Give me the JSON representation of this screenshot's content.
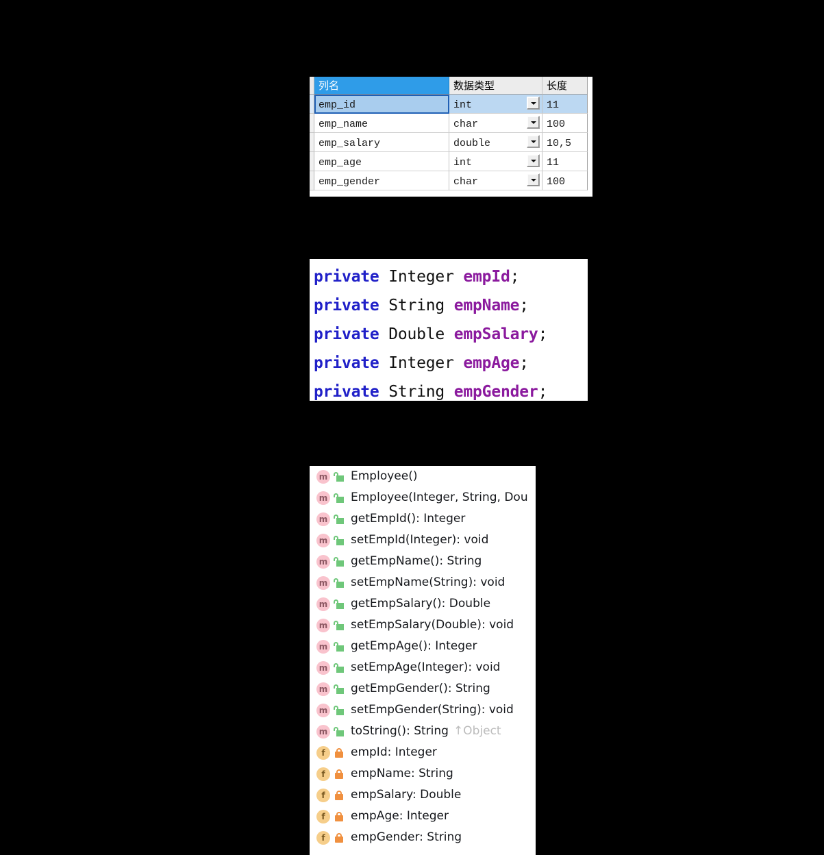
{
  "db_table": {
    "headers": [
      "列名",
      "数据类型",
      "长度"
    ],
    "rows": [
      {
        "column_name": "emp_id",
        "data_type": "int",
        "length": "11",
        "selected": true
      },
      {
        "column_name": "emp_name",
        "data_type": "char",
        "length": "100",
        "selected": false
      },
      {
        "column_name": "emp_salary",
        "data_type": "double",
        "length": "10,5",
        "selected": false
      },
      {
        "column_name": "emp_age",
        "data_type": "int",
        "length": "11",
        "selected": false
      },
      {
        "column_name": "emp_gender",
        "data_type": "char",
        "length": "100",
        "selected": false
      }
    ],
    "dropdown_icon": "chevron-down-icon",
    "header_accent_color": "#2f9ce8",
    "selection_color": "#bcd8f2"
  },
  "code_block": {
    "language": "java",
    "keyword_color": "#2020c8",
    "field_color": "#8b1a9e",
    "lines": [
      {
        "keyword": "private",
        "type": "Integer",
        "name": "empId",
        "terminator": ";"
      },
      {
        "keyword": "private",
        "type": "String",
        "name": "empName",
        "terminator": ";"
      },
      {
        "keyword": "private",
        "type": "Double",
        "name": "empSalary",
        "terminator": ";"
      },
      {
        "keyword": "private",
        "type": "Integer",
        "name": "empAge",
        "terminator": ";"
      },
      {
        "keyword": "private",
        "type": "String",
        "name": "empGender",
        "terminator": ";"
      }
    ]
  },
  "outline": {
    "method_icon": "method-disc-icon",
    "field_icon": "field-disc-icon",
    "public_icon": "green-open-padlock-icon",
    "private_icon": "orange-closed-padlock-icon",
    "items": [
      {
        "kind": "m",
        "visibility": "public",
        "label": "Employee()",
        "override": ""
      },
      {
        "kind": "m",
        "visibility": "public",
        "label": "Employee(Integer, String, Dou",
        "override": ""
      },
      {
        "kind": "m",
        "visibility": "public",
        "label": "getEmpId(): Integer",
        "override": ""
      },
      {
        "kind": "m",
        "visibility": "public",
        "label": "setEmpId(Integer): void",
        "override": ""
      },
      {
        "kind": "m",
        "visibility": "public",
        "label": "getEmpName(): String",
        "override": ""
      },
      {
        "kind": "m",
        "visibility": "public",
        "label": "setEmpName(String): void",
        "override": ""
      },
      {
        "kind": "m",
        "visibility": "public",
        "label": "getEmpSalary(): Double",
        "override": ""
      },
      {
        "kind": "m",
        "visibility": "public",
        "label": "setEmpSalary(Double): void",
        "override": ""
      },
      {
        "kind": "m",
        "visibility": "public",
        "label": "getEmpAge(): Integer",
        "override": ""
      },
      {
        "kind": "m",
        "visibility": "public",
        "label": "setEmpAge(Integer): void",
        "override": ""
      },
      {
        "kind": "m",
        "visibility": "public",
        "label": "getEmpGender(): String",
        "override": ""
      },
      {
        "kind": "m",
        "visibility": "public",
        "label": "setEmpGender(String): void",
        "override": ""
      },
      {
        "kind": "m",
        "visibility": "public",
        "label": "toString(): String",
        "override": "↑Object"
      },
      {
        "kind": "f",
        "visibility": "private",
        "label": "empId: Integer",
        "override": ""
      },
      {
        "kind": "f",
        "visibility": "private",
        "label": "empName: String",
        "override": ""
      },
      {
        "kind": "f",
        "visibility": "private",
        "label": "empSalary: Double",
        "override": ""
      },
      {
        "kind": "f",
        "visibility": "private",
        "label": "empAge: Integer",
        "override": ""
      },
      {
        "kind": "f",
        "visibility": "private",
        "label": "empGender: String",
        "override": ""
      }
    ]
  }
}
